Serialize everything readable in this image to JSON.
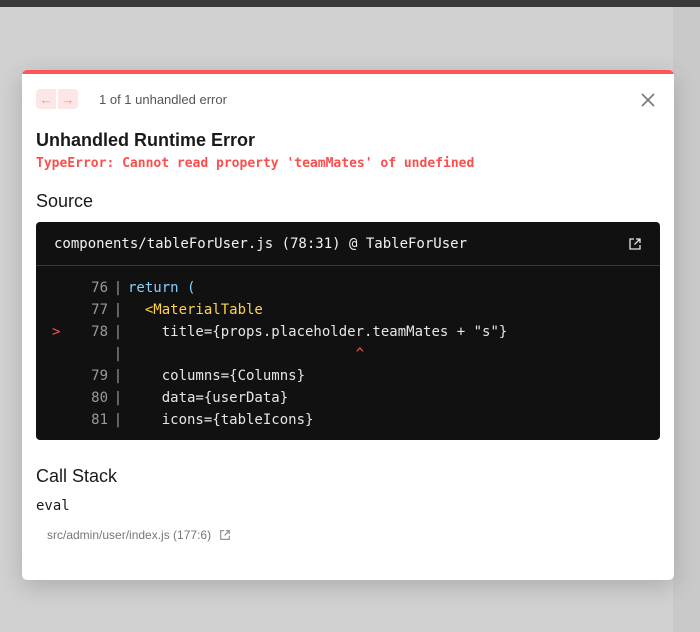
{
  "header": {
    "error_count": "1 of 1 unhandled error"
  },
  "error": {
    "title": "Unhandled Runtime Error",
    "message": "TypeError: Cannot read property 'teamMates' of undefined"
  },
  "source": {
    "section_title": "Source",
    "file_header": "components/tableForUser.js (78:31) @ TableForUser",
    "lines": [
      {
        "marker": "",
        "number": "76",
        "code": "return ("
      },
      {
        "marker": "",
        "number": "77",
        "code": "<MaterialTable"
      },
      {
        "marker": ">",
        "number": "78",
        "code": "title={props.placeholder.teamMates + \"s\"}"
      },
      {
        "marker": "",
        "number": "",
        "code": "^"
      },
      {
        "marker": "",
        "number": "79",
        "code": "columns={Columns}"
      },
      {
        "marker": "",
        "number": "80",
        "code": "data={userData}"
      },
      {
        "marker": "",
        "number": "81",
        "code": "icons={tableIcons}"
      }
    ]
  },
  "call_stack": {
    "section_title": "Call Stack",
    "function": "eval",
    "file": "src/admin/user/index.js (177:6)"
  },
  "icons": {
    "prev": "arrow-left-icon",
    "next": "arrow-right-icon",
    "close": "close-icon",
    "external": "external-link-icon"
  },
  "colors": {
    "accent": "#ff5555",
    "error_text": "#ff4d4d",
    "code_bg": "#111111"
  }
}
